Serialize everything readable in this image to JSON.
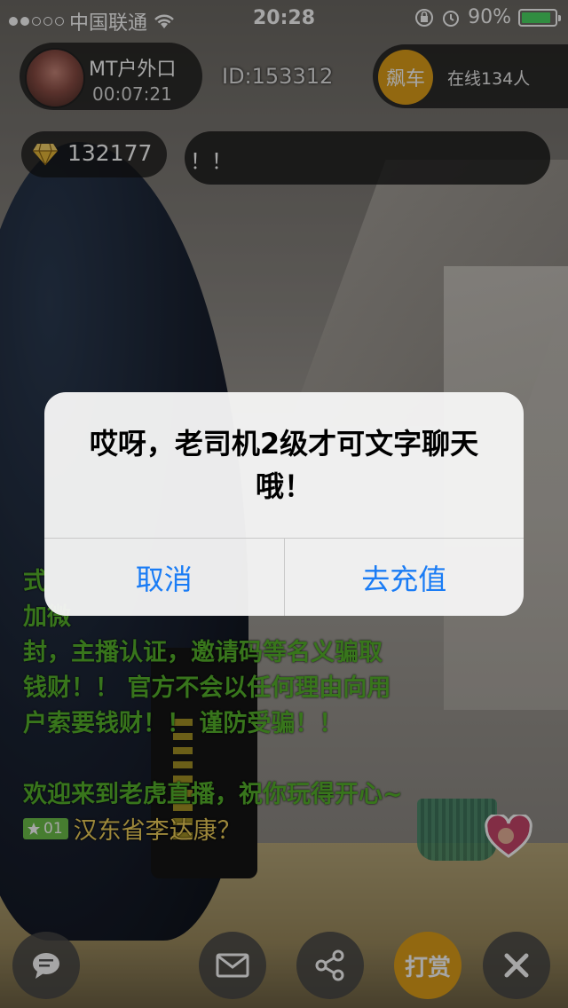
{
  "status_bar": {
    "carrier": "中国联通",
    "time": "20:28",
    "battery": "90%",
    "battery_level": 0.9
  },
  "host": {
    "name": "MT户外口",
    "duration": "00:07:21"
  },
  "room": {
    "id": "ID:153312"
  },
  "online": {
    "car_label": "飙车",
    "count_text": "在线134人"
  },
  "diamonds": {
    "count": "132177"
  },
  "notice": {
    "text": "！！"
  },
  "chat": {
    "lines": [
      "式",
      "加微",
      "封，主播认证，邀请码等名义骗取",
      "钱财！！ 官方不会以任何理由向用",
      "户索要钱财！！ 谨防受骗！！",
      "",
      "欢迎来到老虎直播，祝你玩得开心~"
    ],
    "user_level": "01",
    "user_message": "汉东省李达康？"
  },
  "bottom_bar": {
    "reward_label": "打赏",
    "icons": [
      "chat-icon",
      "mail-icon",
      "share-icon",
      "close-icon"
    ]
  },
  "alert": {
    "message": "哎呀，老司机2级才可文字聊天哦！",
    "cancel_label": "取消",
    "recharge_label": "去充值",
    "button_color": "#1a7cf5"
  }
}
